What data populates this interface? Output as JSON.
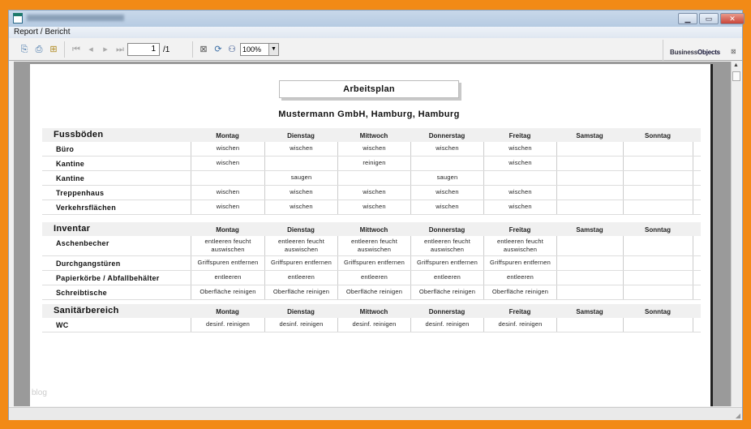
{
  "window": {
    "menu": "Report / Bericht",
    "page_current": "1",
    "page_total": "/1",
    "zoom": "100%",
    "brand_a": "Business",
    "brand_b": "Objects",
    "watermark": "blog"
  },
  "report": {
    "title": "Arbeitsplan",
    "company": "Mustermann GmbH, Hamburg, Hamburg"
  },
  "days": [
    "Montag",
    "Dienstag",
    "Mittwoch",
    "Donnerstag",
    "Freitag",
    "Samstag",
    "Sonntag"
  ],
  "sections": [
    {
      "name": "Fussböden",
      "rows": [
        {
          "label": "Büro",
          "cells": [
            "wischen",
            "wischen",
            "wischen",
            "wischen",
            "wischen",
            "",
            ""
          ]
        },
        {
          "label": "Kantine",
          "cells": [
            "wischen",
            "",
            "reinigen",
            "",
            "wischen",
            "",
            ""
          ]
        },
        {
          "label": "Kantine",
          "cells": [
            "",
            "saugen",
            "",
            "saugen",
            "",
            "",
            ""
          ]
        },
        {
          "label": "Treppenhaus",
          "cells": [
            "wischen",
            "wischen",
            "wischen",
            "wischen",
            "wischen",
            "",
            ""
          ]
        },
        {
          "label": "Verkehrsflächen",
          "cells": [
            "wischen",
            "wischen",
            "wischen",
            "wischen",
            "wischen",
            "",
            ""
          ]
        }
      ]
    },
    {
      "name": "Inventar",
      "rows": [
        {
          "label": "Aschenbecher",
          "cells": [
            "entleeren feucht auswischen",
            "entleeren feucht auswischen",
            "entleeren feucht auswischen",
            "entleeren feucht auswischen",
            "entleeren feucht auswischen",
            "",
            ""
          ]
        },
        {
          "label": "Durchgangstüren",
          "cells": [
            "Griffspuren entfernen",
            "Griffspuren entfernen",
            "Griffspuren entfernen",
            "Griffspuren entfernen",
            "Griffspuren entfernen",
            "",
            ""
          ]
        },
        {
          "label": "Papierkörbe / Abfallbehälter",
          "cells": [
            "entleeren",
            "entleeren",
            "entleeren",
            "entleeren",
            "entleeren",
            "",
            ""
          ]
        },
        {
          "label": "Schreibtische",
          "cells": [
            "Oberfläche reinigen",
            "Oberfläche reinigen",
            "Oberfläche reinigen",
            "Oberfläche reinigen",
            "Oberfläche reinigen",
            "",
            ""
          ]
        }
      ]
    },
    {
      "name": "Sanitärbereich",
      "rows": [
        {
          "label": "WC",
          "cells": [
            "desinf. reinigen",
            "desinf. reinigen",
            "desinf. reinigen",
            "desinf. reinigen",
            "desinf. reinigen",
            "",
            ""
          ]
        }
      ]
    }
  ]
}
